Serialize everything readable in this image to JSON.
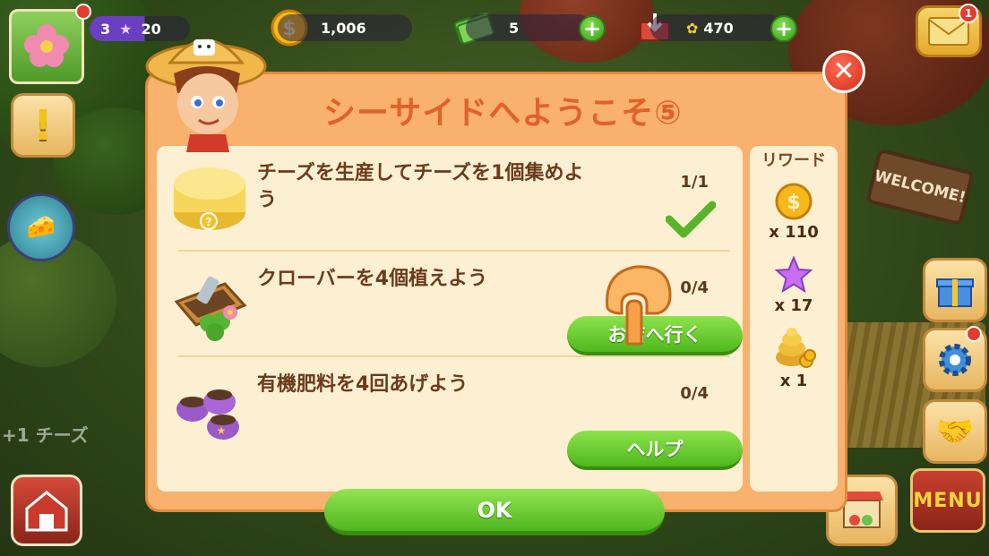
{
  "hud": {
    "level": "3",
    "stars": "20",
    "coins": "1,006",
    "cash": "5",
    "storage": "470",
    "mail_badge": "1"
  },
  "dialog": {
    "title": "シーサイドへようこそ⑤",
    "reward_header": "リワード",
    "tasks": [
      {
        "text": "チーズを生産してチーズを1個集めよう",
        "progress": "1/1",
        "completed": true
      },
      {
        "text": "クローバーを4個植えよう",
        "progress": "0/4",
        "button": "お店へ行く"
      },
      {
        "text": "有機肥料を4回あげよう",
        "progress": "0/4",
        "button": "ヘルプ"
      }
    ],
    "rewards": [
      {
        "icon": "coin-icon",
        "qty": "x 110"
      },
      {
        "icon": "star-icon",
        "qty": "x 17"
      },
      {
        "icon": "beehive-icon",
        "qty": "x 1"
      }
    ],
    "ok_label": "OK"
  },
  "scene": {
    "floating_text": "+1 チーズ",
    "welcome_sign": "WELCOME!",
    "menu_label": "MENU"
  },
  "colors": {
    "dialog_bg": "#f8b26d",
    "panel_bg": "#fcefd2",
    "title": "#e0622a",
    "button_green": "#4eb81c",
    "close_red": "#d3301c"
  }
}
